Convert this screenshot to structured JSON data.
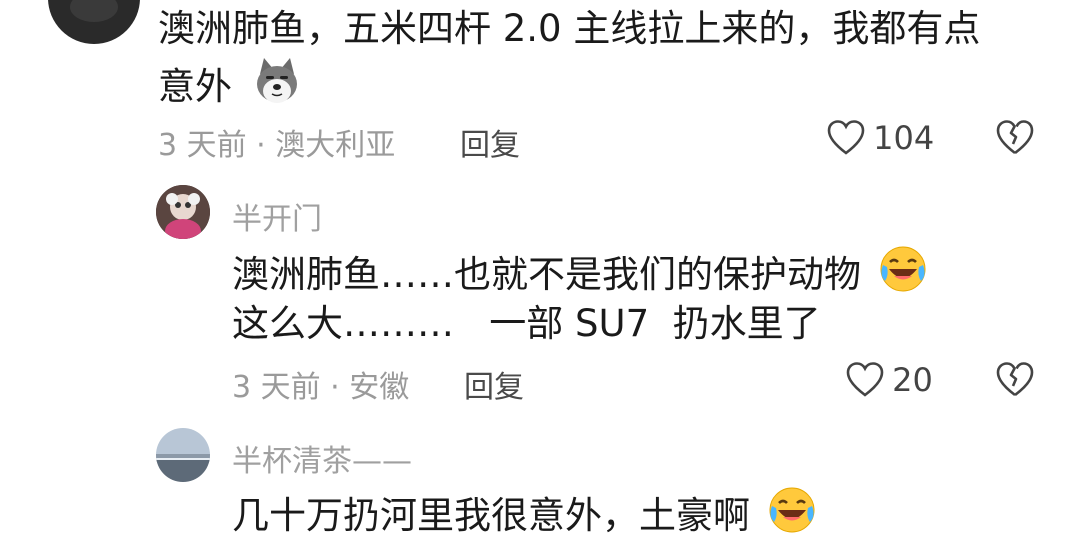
{
  "comments": [
    {
      "text_line1": "澳洲肺鱼，五米四杆 2.0 主线拉上来的，我都有点",
      "text_line2": "意外",
      "emoji": "doge-icon",
      "meta": "3 天前 · 澳大利亚",
      "reply_label": "回复",
      "likes": "104"
    },
    {
      "username": "半开门",
      "text_line1": "澳洲肺鱼……也就不是我们的保护动物",
      "text_line2": "这么大………   一部 SU7  扔水里了",
      "emoji": "laugh-cry-icon",
      "meta": "3 天前 · 安徽",
      "reply_label": "回复",
      "likes": "20"
    },
    {
      "username": "半杯清茶——",
      "text_line1": "几十万扔河里我很意外，土豪啊",
      "emoji": "laugh-cry-icon"
    }
  ]
}
